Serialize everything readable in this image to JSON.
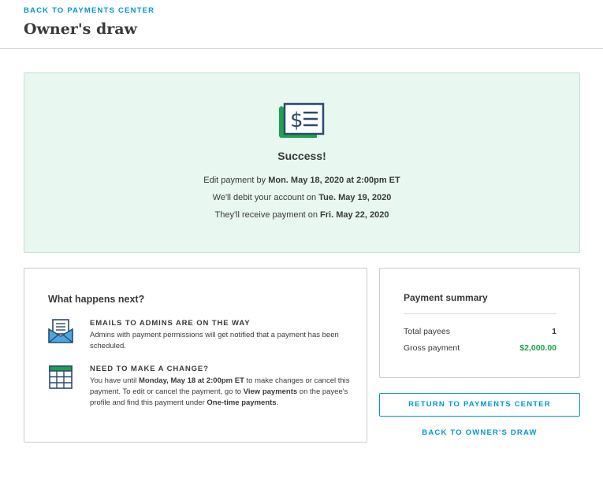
{
  "header": {
    "back_link": "BACK TO PAYMENTS CENTER",
    "title": "Owner's draw"
  },
  "success": {
    "icon": "check-payment-icon",
    "title": "Success!",
    "line1_prefix": "Edit payment by ",
    "line1_value": "Mon. May 18, 2020 at 2:00pm ET",
    "line2_prefix": "We'll debit your account on ",
    "line2_value": "Tue. May 19, 2020",
    "line3_prefix": "They'll receive payment on ",
    "line3_value": "Fri. May 22, 2020"
  },
  "next": {
    "heading": "What happens next?",
    "item1": {
      "icon": "envelope-icon",
      "title": "EMAILS TO ADMINS ARE ON THE WAY",
      "desc": "Admins with payment permissions will get notified that a payment has been scheduled."
    },
    "item2": {
      "icon": "calendar-icon",
      "title": "NEED TO MAKE A CHANGE?",
      "desc_part1": "You have until ",
      "desc_bold1": "Monday, May 18 at 2:00pm ET",
      "desc_part2": " to make changes or cancel this payment. To edit or cancel the payment, go to ",
      "desc_bold2": "View payments",
      "desc_part3": " on the payee's profile and find this payment under ",
      "desc_bold3": "One-time payments",
      "desc_part4": "."
    }
  },
  "summary": {
    "title": "Payment summary",
    "rows": [
      {
        "label": "Total payees",
        "value": "1"
      },
      {
        "label": "Gross payment",
        "value": "$2,000.00"
      }
    ]
  },
  "actions": {
    "return_label": "RETURN TO PAYMENTS CENTER",
    "back_owner_label": "BACK TO OWNER'S DRAW"
  },
  "colors": {
    "link": "#0096d7",
    "success_bg": "#e8f7ef",
    "accent_green": "#1ca24c",
    "icon_navy": "#2b4a6f"
  }
}
